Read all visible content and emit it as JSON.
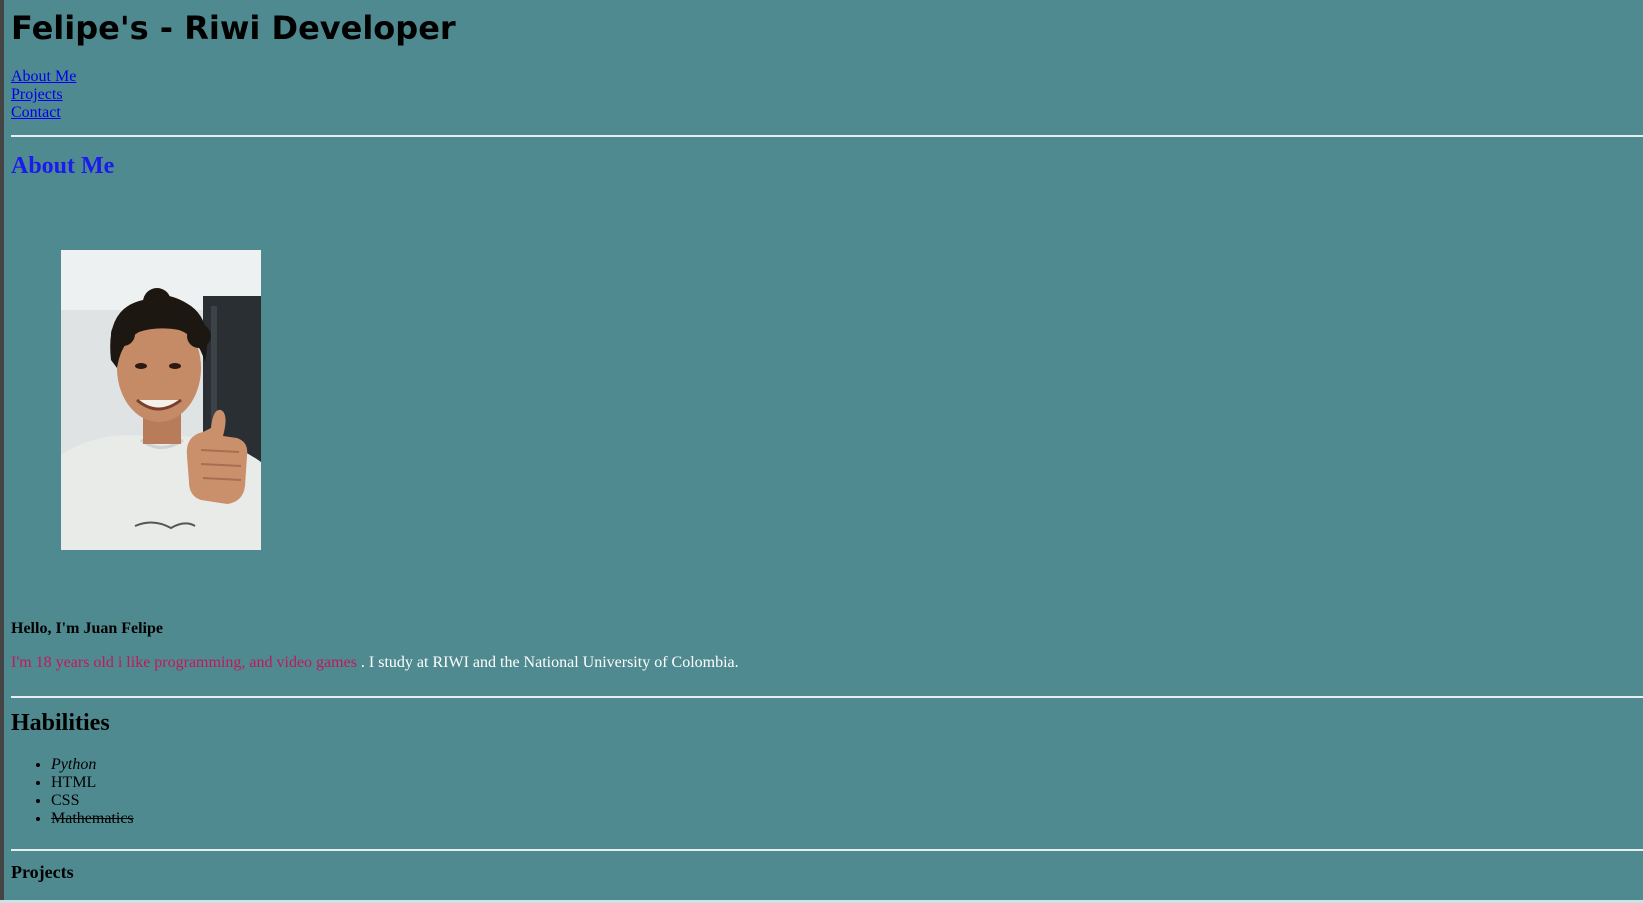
{
  "header": {
    "title": "Felipe's - Riwi Developer"
  },
  "nav": {
    "items": [
      {
        "label": "About Me"
      },
      {
        "label": "Projects"
      },
      {
        "label": "Contact"
      }
    ]
  },
  "about": {
    "heading": "About Me",
    "photo_alt": "Profile photo of Juan Felipe giving a thumbs up",
    "greeting": "Hello, I'm Juan Felipe",
    "bio_highlight": "I'm 18 years old i like programming, and video games",
    "bio_rest": " . I study at RIWI and the National University of Colombia."
  },
  "habilities": {
    "heading": "Habilities",
    "items": [
      {
        "label": "Python",
        "style": "italic"
      },
      {
        "label": "HTML",
        "style": "normal"
      },
      {
        "label": "CSS",
        "style": "normal"
      },
      {
        "label": "Mathematics",
        "style": "strikethrough"
      }
    ]
  },
  "projects": {
    "heading": "Projects"
  },
  "colors": {
    "background": "#4f8a90",
    "link": "#0000ee",
    "heading_blue": "#1b1bee",
    "bio_highlight": "#c2185b",
    "bio_text": "#ffffff",
    "rule": "#e8eded"
  }
}
